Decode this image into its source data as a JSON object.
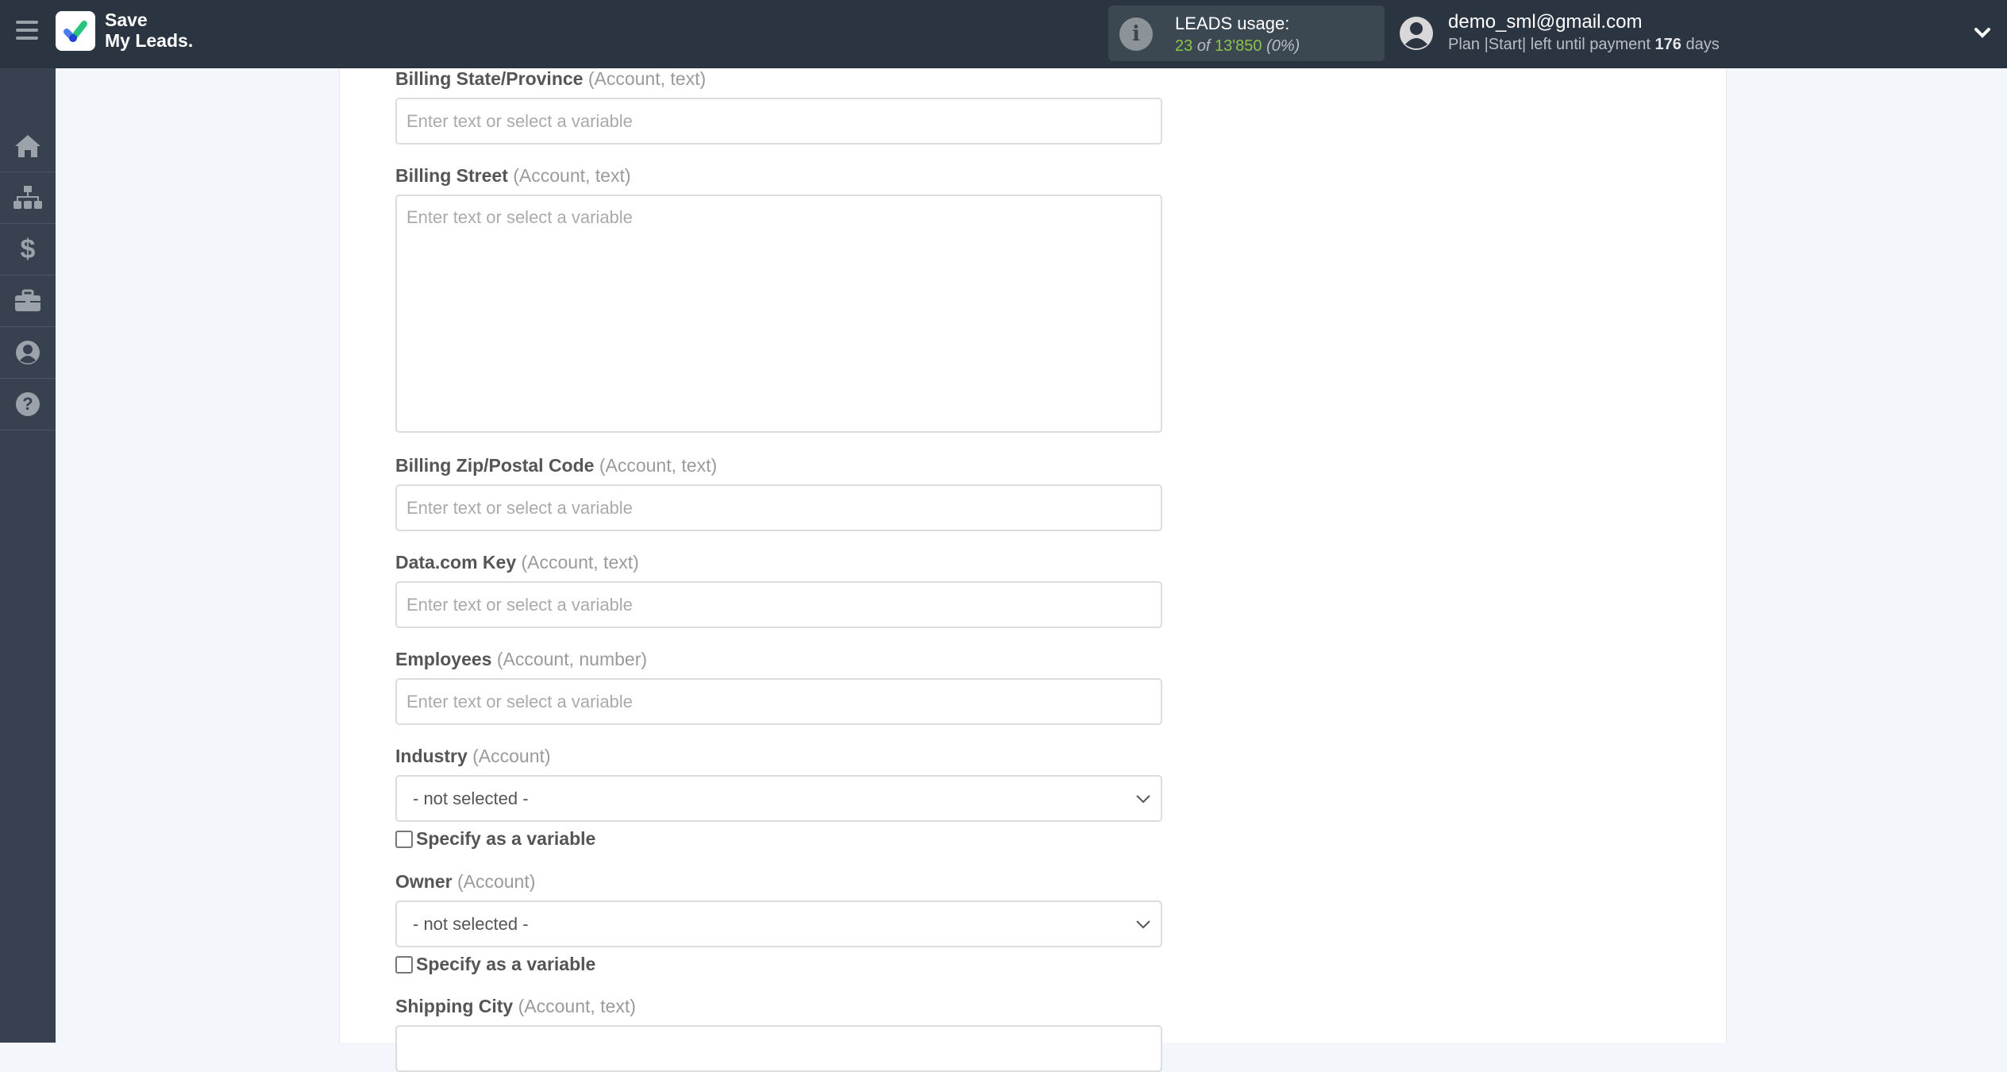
{
  "header": {
    "brand_line1": "Save",
    "brand_line2": "My Leads.",
    "usage": {
      "title": "LEADS usage:",
      "used": "23",
      "of_label": "of",
      "total": "13'850",
      "percent": "(0%)"
    },
    "user": {
      "email": "demo_sml@gmail.com",
      "plan_prefix": "Plan |Start| left until payment",
      "days": "176",
      "days_suffix": "days"
    }
  },
  "sidebar": {
    "items": [
      {
        "icon": "home-icon"
      },
      {
        "icon": "sitemap-icon"
      },
      {
        "icon": "dollar-icon"
      },
      {
        "icon": "briefcase-icon"
      },
      {
        "icon": "user-circle-icon"
      },
      {
        "icon": "help-icon"
      }
    ]
  },
  "form": {
    "fields": [
      {
        "label": "Billing State/Province",
        "hint": "(Account, text)",
        "placeholder": "Enter text or select a variable"
      },
      {
        "label": "Billing Street",
        "hint": "(Account, text)",
        "placeholder": "Enter text or select a variable"
      },
      {
        "label": "Billing Zip/Postal Code",
        "hint": "(Account, text)",
        "placeholder": "Enter text or select a variable"
      },
      {
        "label": "Data.com Key",
        "hint": "(Account, text)",
        "placeholder": "Enter text or select a variable"
      },
      {
        "label": "Employees",
        "hint": "(Account, number)",
        "placeholder": "Enter text or select a variable"
      },
      {
        "label": "Industry",
        "hint": "(Account)",
        "value": "- not selected -",
        "checkbox": "Specify as a variable"
      },
      {
        "label": "Owner",
        "hint": "(Account)",
        "value": "- not selected -",
        "checkbox": "Specify as a variable"
      },
      {
        "label": "Shipping City",
        "hint": "(Account, text)"
      }
    ]
  }
}
